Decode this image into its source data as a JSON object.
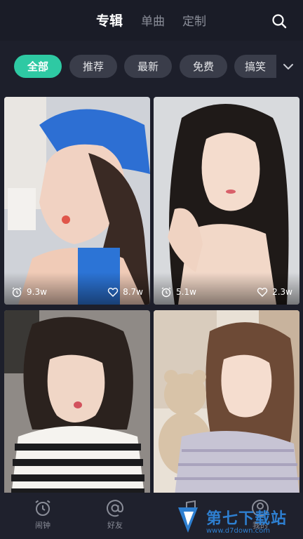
{
  "header": {
    "tabs": [
      {
        "label": "专辑",
        "active": true
      },
      {
        "label": "单曲",
        "active": false
      },
      {
        "label": "定制",
        "active": false
      }
    ],
    "search_icon": "search-icon"
  },
  "filters": {
    "chips": [
      {
        "label": "全部",
        "active": true
      },
      {
        "label": "推荐",
        "active": false
      },
      {
        "label": "最新",
        "active": false
      },
      {
        "label": "免费",
        "active": false
      },
      {
        "label": "搞笑",
        "active": false
      }
    ],
    "more_icon": "chevron-down-icon"
  },
  "cards": [
    {
      "plays": "9.3w",
      "likes": "8.7w"
    },
    {
      "plays": "5.1w",
      "likes": "2.3w"
    },
    {
      "plays": "",
      "likes": ""
    },
    {
      "plays": "",
      "likes": ""
    }
  ],
  "bottom_nav": [
    {
      "label": "闹钟",
      "icon": "alarm-clock-icon"
    },
    {
      "label": "好友",
      "icon": "at-sign-icon"
    },
    {
      "label": "",
      "icon": "music-icon"
    },
    {
      "label": "我的",
      "icon": "user-icon"
    }
  ],
  "watermark": {
    "title": "第七下载站",
    "url": "www.d7down.com"
  },
  "colors": {
    "accent": "#2ec9a3",
    "background": "#1d1f2b",
    "chip": "#3a3d4a"
  }
}
